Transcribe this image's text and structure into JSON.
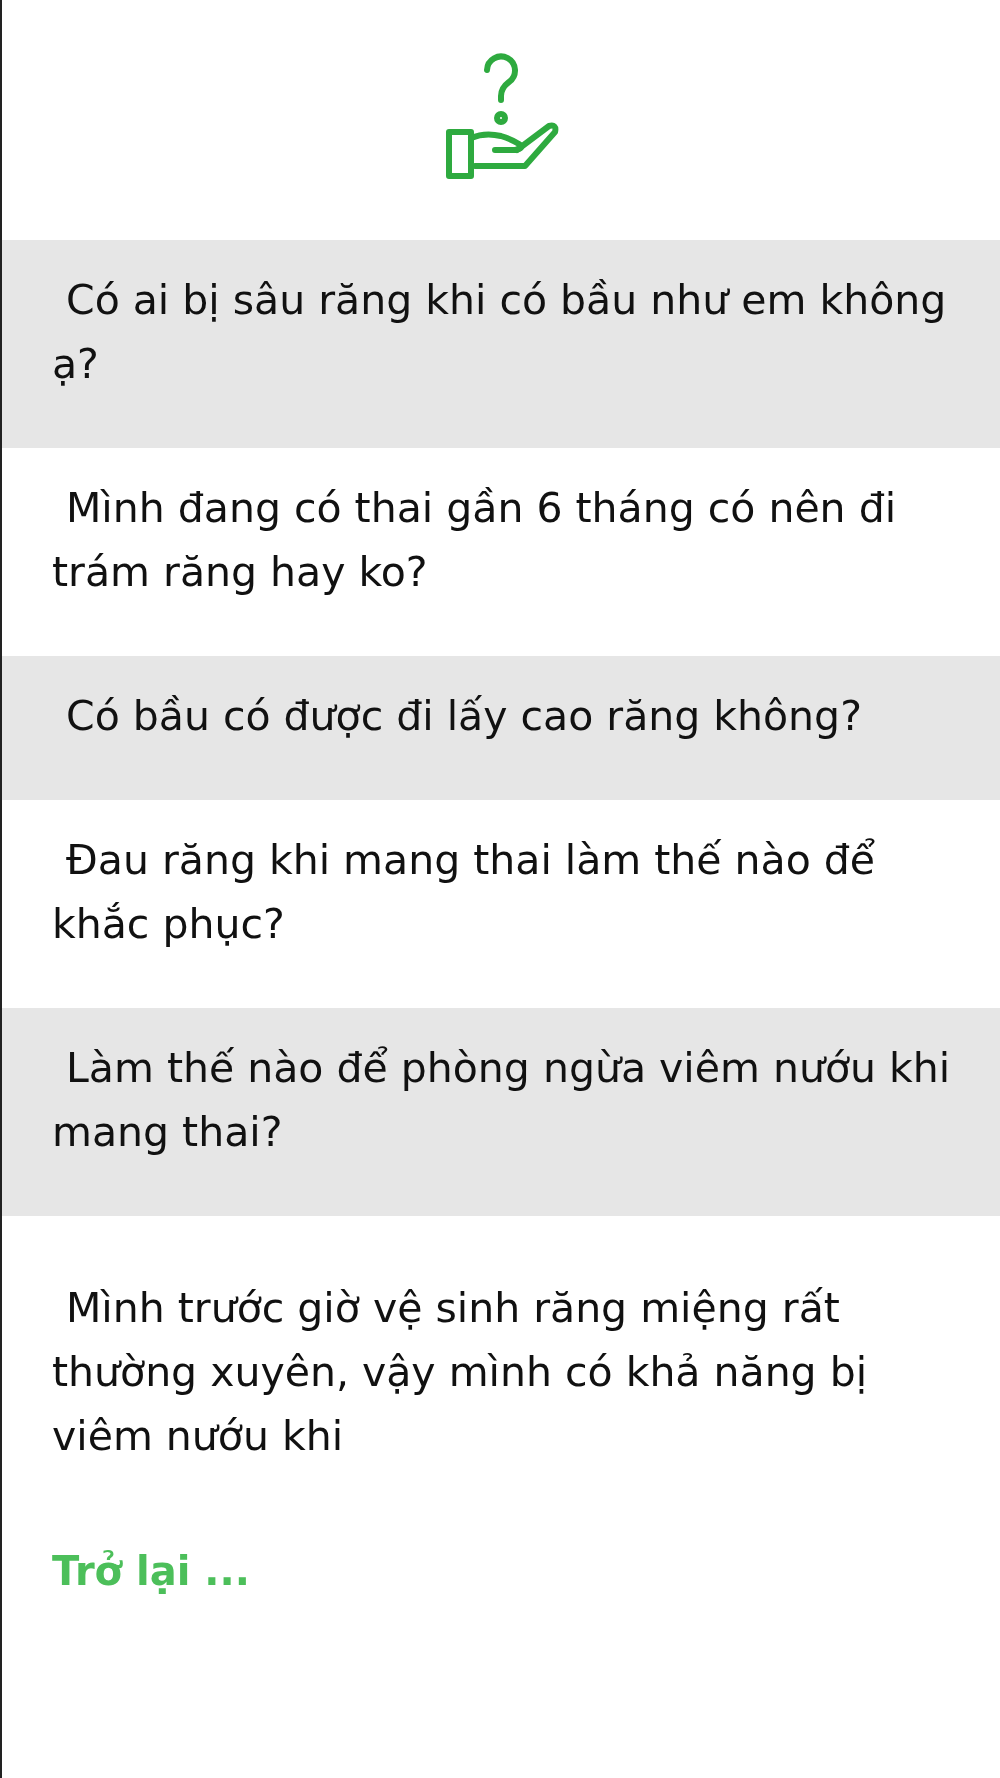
{
  "questions": [
    {
      "text": "Có ai bị sâu răng khi có bầu như em không ạ?"
    },
    {
      "text": "Mình đang có thai gần 6 tháng có nên đi trám răng hay ko?"
    },
    {
      "text": "Có bầu có được đi lấy cao răng không?"
    },
    {
      "text": "Đau răng khi mang thai làm thế nào để khắc phục?"
    },
    {
      "text": "Làm thế nào để phòng ngừa viêm nướu khi mang thai?"
    },
    {
      "text": "Mình trước giờ vệ sinh răng miệng rất thường xuyên, vậy mình có khả năng bị viêm nướu khi"
    }
  ],
  "back_link": "Trở lại ..."
}
